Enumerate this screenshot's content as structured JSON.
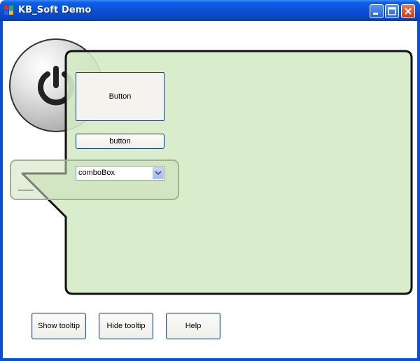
{
  "window": {
    "title": "KB_Soft Demo"
  },
  "controls": {
    "big_button_label": "Button",
    "small_button_label": "button",
    "combo_value": "comboBox"
  },
  "bottom_buttons": {
    "show_tooltip": "Show tooltip",
    "hide_tooltip": "Hide tooltip",
    "help": "Help"
  },
  "colors": {
    "titlebar": "#0a52d8",
    "panel_fill": "#dcecd0",
    "panel_border": "#111111",
    "button_border": "#003c74"
  },
  "icons": {
    "app": "app-icon",
    "minimize": "minimize-icon",
    "maximize": "maximize-icon",
    "close": "close-icon",
    "power": "power-icon",
    "dropdown": "chevron-down-icon"
  }
}
